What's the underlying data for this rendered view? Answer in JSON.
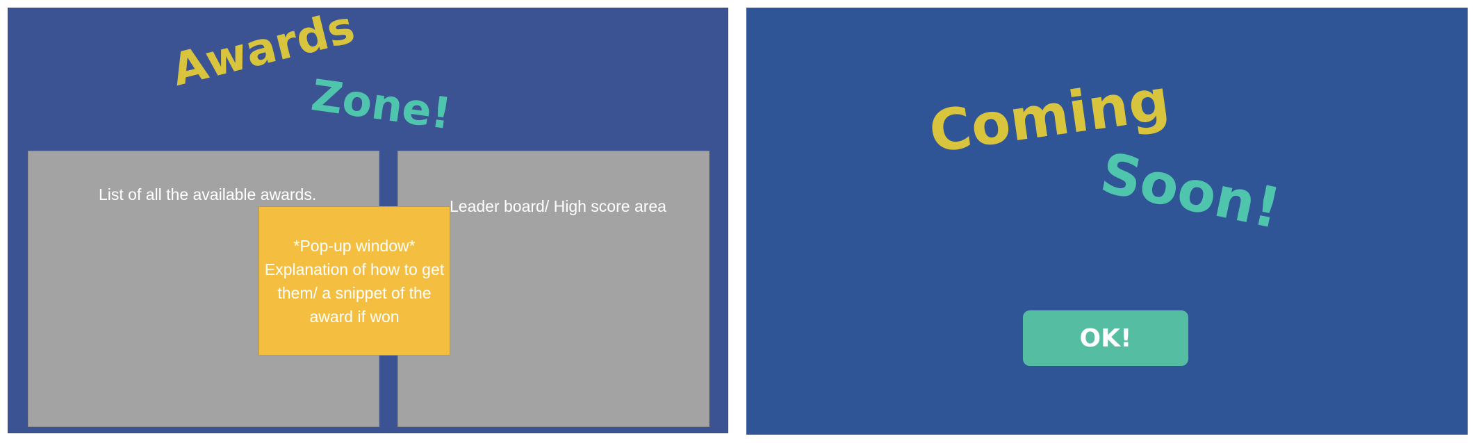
{
  "awards_screen": {
    "title_word_1": "Awards",
    "title_word_2": "Zone!",
    "awards_list_text": "List of all the available awards.",
    "leaderboard_text": "Leader board/ High score area",
    "popup_text": "*Pop-up window*\nExplanation of how to get them/ a snippet of the award if won"
  },
  "coming_soon_screen": {
    "word_1": "Coming",
    "word_2": "Soon!",
    "ok_button_label": "OK!"
  },
  "colors": {
    "left_background": "#3b5393",
    "right_background": "#2f5597",
    "gold_text": "#d8c43d",
    "teal_text": "#4fc5ad",
    "panel_gray": "#a3a3a3",
    "popup_yellow": "#f4bf40",
    "ok_button_green": "#55bea2"
  }
}
